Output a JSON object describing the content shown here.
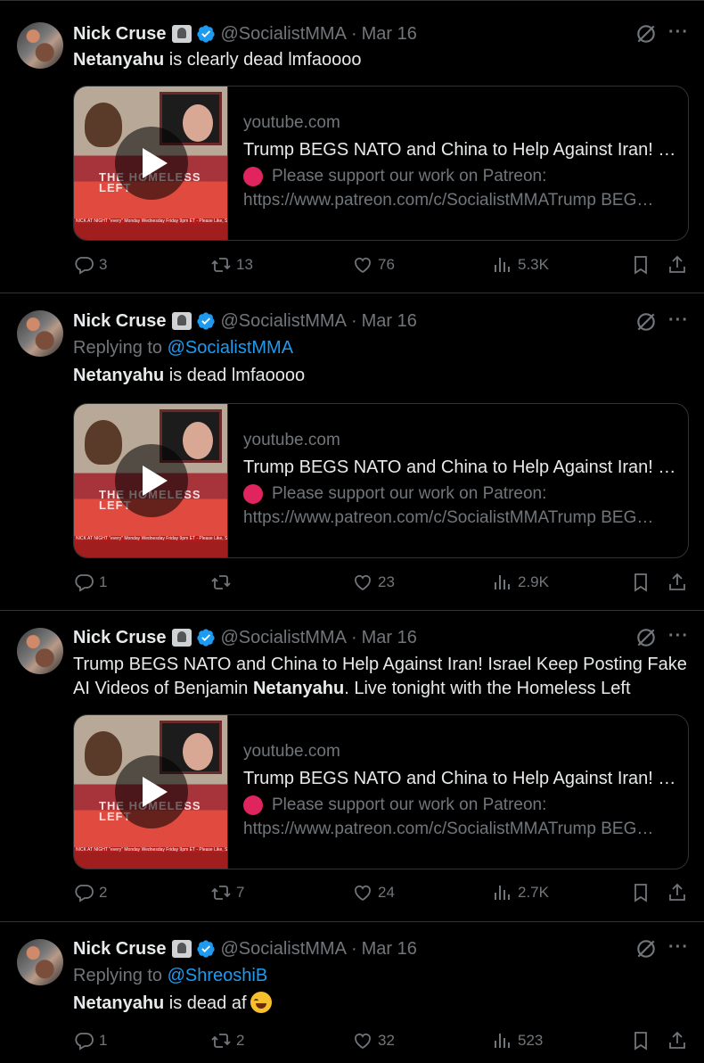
{
  "author": {
    "name": "Nick Cruse",
    "handle": "@SocialistMMA",
    "date": "Mar 16"
  },
  "colors": {
    "background": "#000000",
    "text": "#e7e9ea",
    "muted": "#71767b",
    "link": "#1d9bf0",
    "verified": "#1d9bf0",
    "divider": "#2f3336"
  },
  "icons": [
    "verified-badge-icon",
    "affiliate-badge-icon",
    "grok-icon",
    "more-icon",
    "reply-icon",
    "retweet-icon",
    "like-icon",
    "views-icon",
    "bookmark-icon",
    "share-icon",
    "play-icon"
  ],
  "card": {
    "domain": "youtube.com",
    "title": "Trump BEGS NATO and China to Help Against Iran! Israel Keep Posting Fake AI Videos of Benjamin Netanyahu. Live tonight with the Homeless Left",
    "desc_line1": "Please support our work on Patreon:",
    "desc_line2": "https://www.patreon.com/c/SocialistMMATrump BEGS NATO and China to Help Against Iran!",
    "thumb_logo": "THE HOMELESS LEFT",
    "thumb_ticker": "NICK AT NIGHT \"every\" Monday Wednesday Friday 9pm ET - Please Like, Share"
  },
  "tweets": [
    {
      "replying_prefix": "",
      "replying_to": "",
      "text_bold": "Netanyahu",
      "text_rest": " is clearly dead lmfaoooo",
      "replies": "3",
      "retweets": "13",
      "likes": "76",
      "views": "5.3K"
    },
    {
      "replying_prefix": "Replying to ",
      "replying_to": "@SocialistMMA",
      "text_bold": "Netanyahu",
      "text_rest": " is dead lmfaoooo",
      "replies": "1",
      "retweets": "",
      "likes": "23",
      "views": "2.9K"
    },
    {
      "replying_prefix": "",
      "replying_to": "",
      "text_pre": "Trump BEGS NATO and China to Help Against Iran! Israel Keep Posting Fake AI Videos of Benjamin ",
      "text_bold": "Netanyahu",
      "text_rest": ". Live tonight with the Homeless Left",
      "replies": "2",
      "retweets": "7",
      "likes": "24",
      "views": "2.7K"
    },
    {
      "replying_prefix": "Replying to ",
      "replying_to": "@ShreoshiB",
      "text_bold": "Netanyahu",
      "text_rest": " is dead af",
      "emoji": "face-with-tears-of-joy",
      "replies": "1",
      "retweets": "2",
      "likes": "32",
      "views": "523"
    }
  ]
}
